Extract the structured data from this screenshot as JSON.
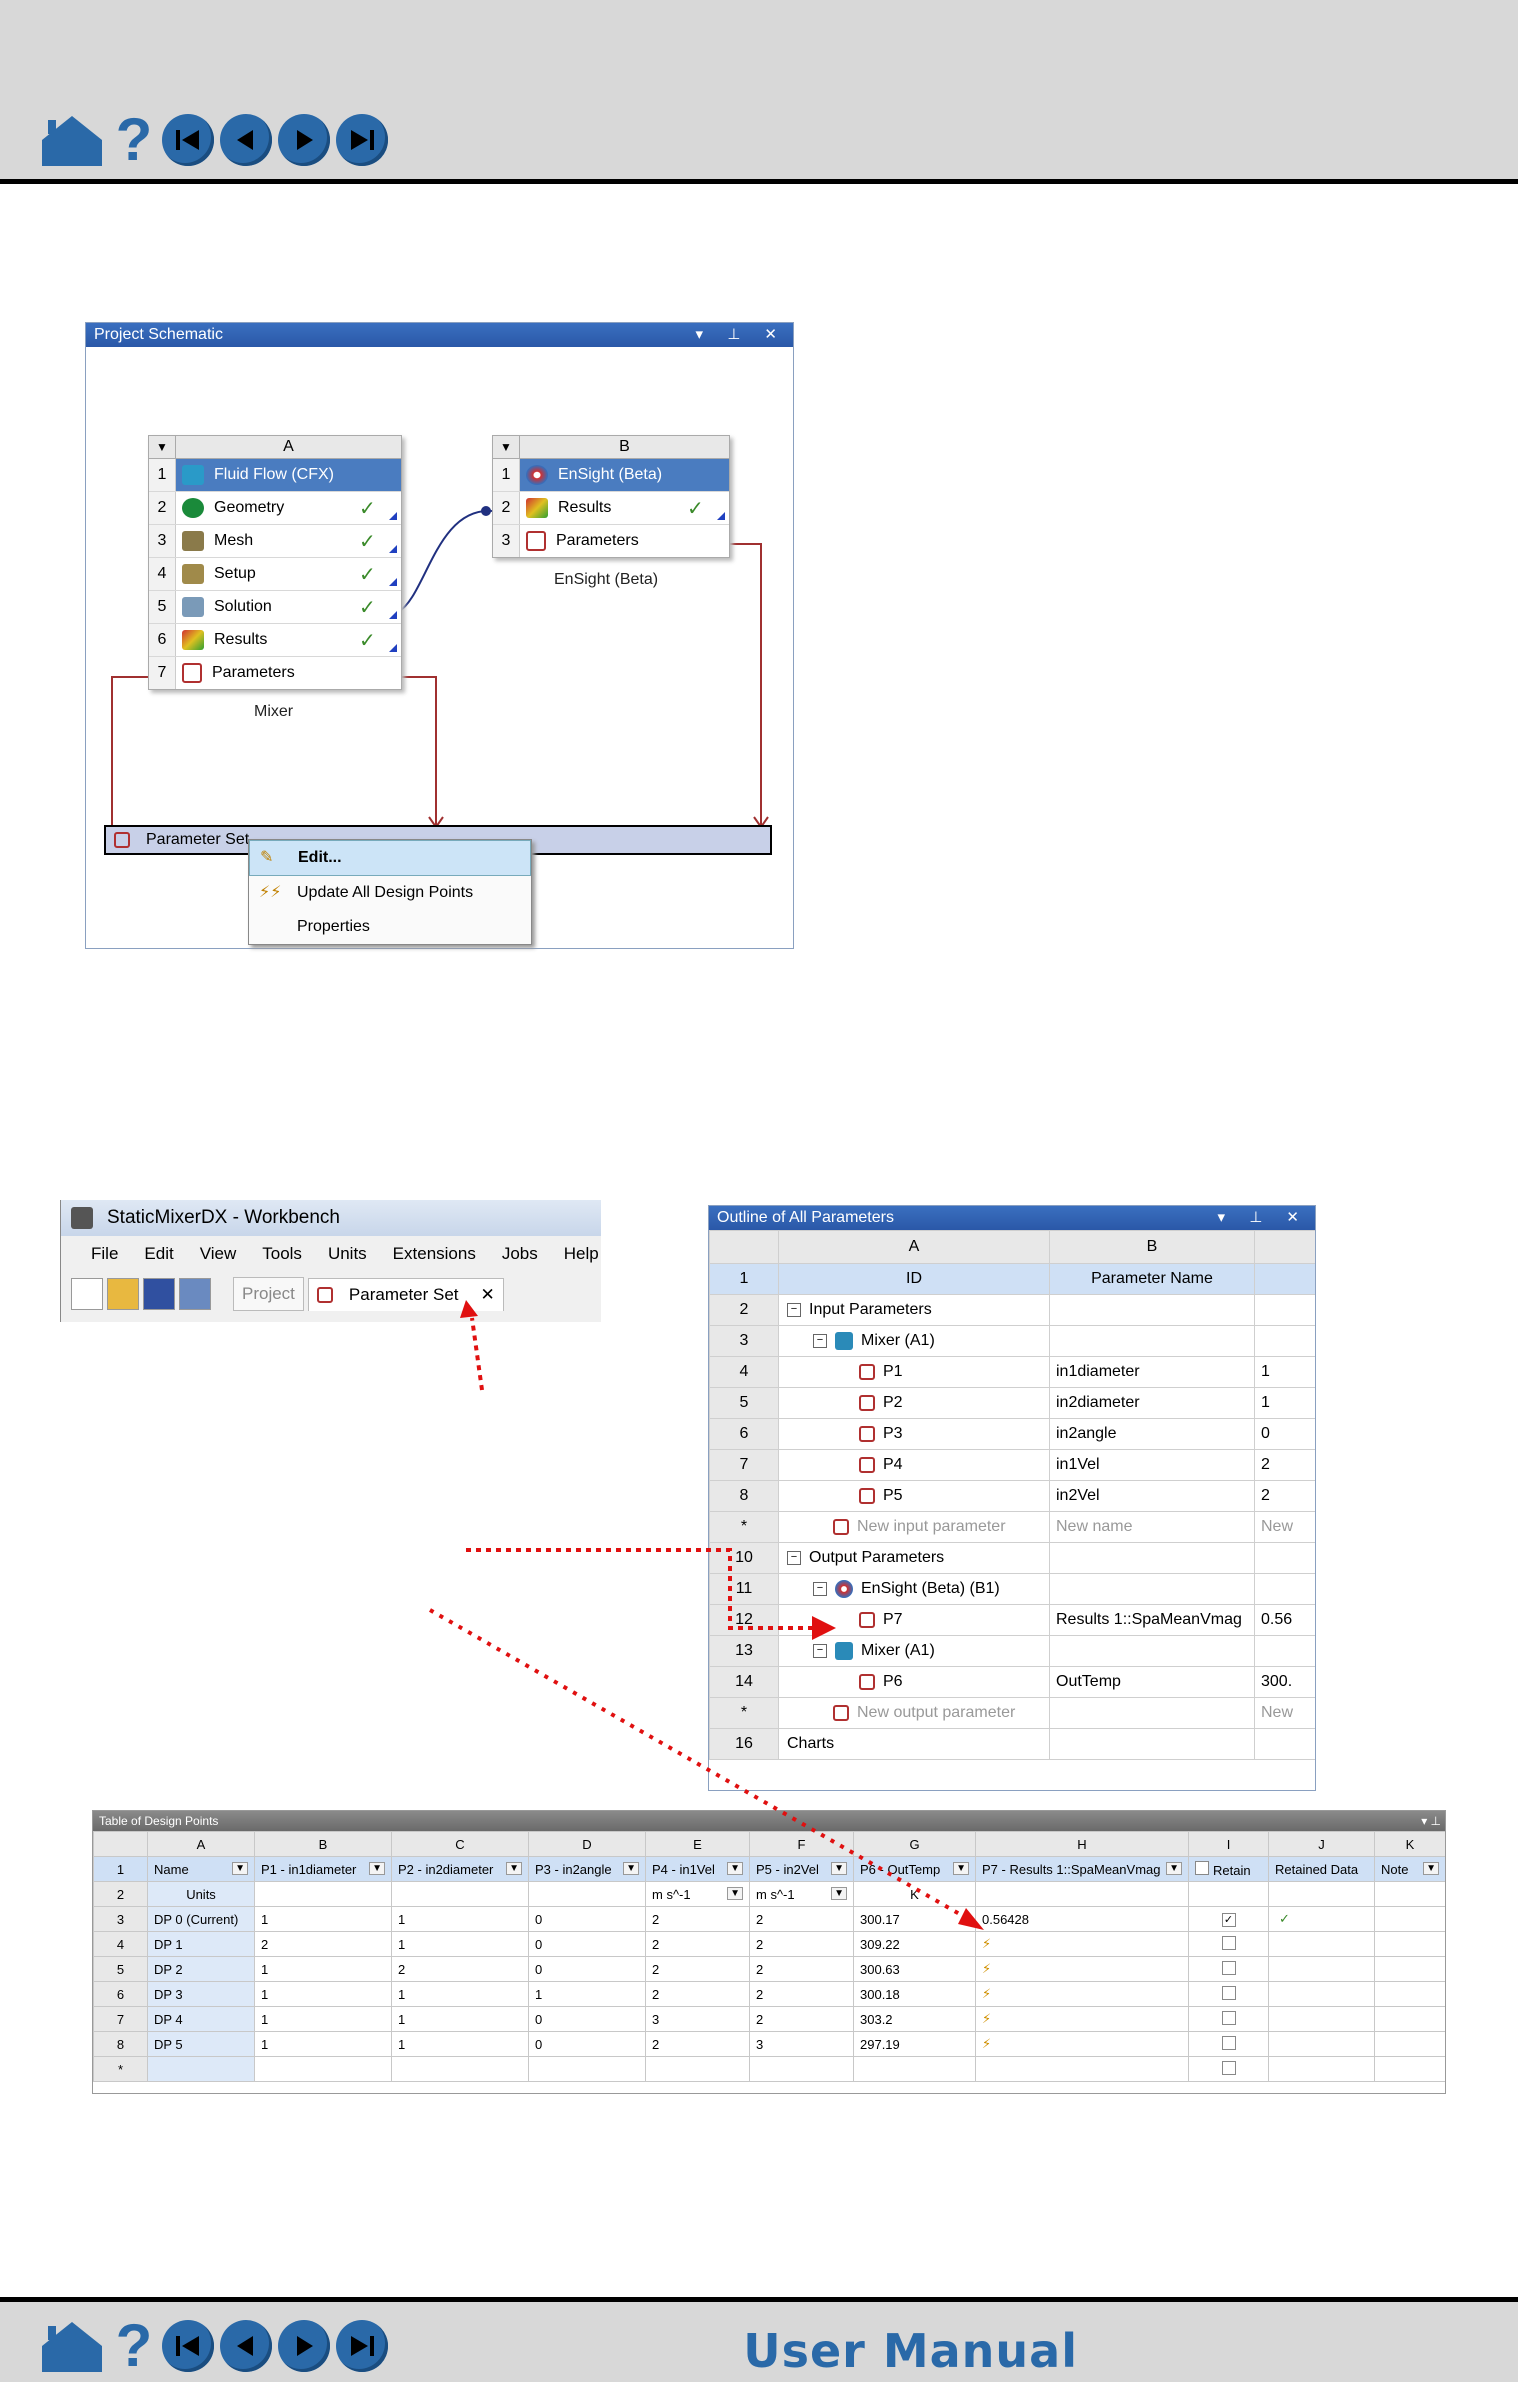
{
  "nav": {
    "help_glyph": "?",
    "footer_title": "User Manual",
    "buttons": [
      "home-icon",
      "help-icon",
      "first-page-icon",
      "prev-page-icon",
      "next-page-icon",
      "last-page-icon"
    ]
  },
  "schematic": {
    "title": "Project Schematic",
    "system_a": {
      "column": "A",
      "rows": [
        {
          "n": "1",
          "label": "Fluid Flow (CFX)",
          "ok": false
        },
        {
          "n": "2",
          "label": "Geometry",
          "ok": true
        },
        {
          "n": "3",
          "label": "Mesh",
          "ok": true
        },
        {
          "n": "4",
          "label": "Setup",
          "ok": true
        },
        {
          "n": "5",
          "label": "Solution",
          "ok": true
        },
        {
          "n": "6",
          "label": "Results",
          "ok": true
        },
        {
          "n": "7",
          "label": "Parameters",
          "ok": false
        }
      ],
      "caption": "Mixer"
    },
    "system_b": {
      "column": "B",
      "rows": [
        {
          "n": "1",
          "label": "EnSight (Beta)",
          "ok": false
        },
        {
          "n": "2",
          "label": "Results",
          "ok": true
        },
        {
          "n": "3",
          "label": "Parameters",
          "ok": false
        }
      ],
      "caption": "EnSight (Beta)"
    },
    "parameter_set": "Parameter Set",
    "menu": {
      "edit": "Edit...",
      "update": "Update All Design Points",
      "properties": "Properties"
    }
  },
  "workbench": {
    "title": "StaticMixerDX - Workbench",
    "menus": [
      "File",
      "Edit",
      "View",
      "Tools",
      "Units",
      "Extensions",
      "Jobs",
      "Help"
    ],
    "tab_project": "Project",
    "tab_param": "Parameter Set",
    "tab_close": "✕"
  },
  "outline": {
    "title": "Outline of All Parameters",
    "col_a": "A",
    "col_b": "B",
    "head_id": "ID",
    "head_name": "Parameter Name",
    "rows": [
      {
        "n": "2",
        "indent": 0,
        "kind": "group",
        "id": "Input Parameters",
        "name": "",
        "val": ""
      },
      {
        "n": "3",
        "indent": 1,
        "kind": "cfx",
        "id": "Mixer (A1)",
        "name": "",
        "val": ""
      },
      {
        "n": "4",
        "indent": 2,
        "kind": "param",
        "id": "P1",
        "name": "in1diameter",
        "val": "1"
      },
      {
        "n": "5",
        "indent": 2,
        "kind": "param",
        "id": "P2",
        "name": "in2diameter",
        "val": "1"
      },
      {
        "n": "6",
        "indent": 2,
        "kind": "param",
        "id": "P3",
        "name": "in2angle",
        "val": "0"
      },
      {
        "n": "7",
        "indent": 2,
        "kind": "param",
        "id": "P4",
        "name": "in1Vel",
        "val": "2"
      },
      {
        "n": "8",
        "indent": 2,
        "kind": "param",
        "id": "P5",
        "name": "in2Vel",
        "val": "2"
      },
      {
        "n": "*",
        "indent": 1,
        "kind": "new",
        "id": "New input parameter",
        "name": "New name",
        "val": "New"
      },
      {
        "n": "10",
        "indent": 0,
        "kind": "group",
        "id": "Output Parameters",
        "name": "",
        "val": ""
      },
      {
        "n": "11",
        "indent": 1,
        "kind": "ens",
        "id": "EnSight (Beta) (B1)",
        "name": "",
        "val": ""
      },
      {
        "n": "12",
        "indent": 2,
        "kind": "param",
        "id": "P7",
        "name": "Results 1::SpaMeanVmag",
        "val": "0.56"
      },
      {
        "n": "13",
        "indent": 1,
        "kind": "cfx",
        "id": "Mixer (A1)",
        "name": "",
        "val": ""
      },
      {
        "n": "14",
        "indent": 2,
        "kind": "param",
        "id": "P6",
        "name": "OutTemp",
        "val": "300."
      },
      {
        "n": "*",
        "indent": 1,
        "kind": "new",
        "id": "New output parameter",
        "name": "",
        "val": "New"
      },
      {
        "n": "16",
        "indent": 0,
        "kind": "plain",
        "id": "Charts",
        "name": "",
        "val": ""
      }
    ]
  },
  "design_points": {
    "title": "Table of Design Points",
    "cols": [
      "A",
      "B",
      "C",
      "D",
      "E",
      "F",
      "G",
      "H",
      "I",
      "J",
      "K"
    ],
    "headers": [
      "Name",
      "P1 - in1diameter",
      "P2 - in2diameter",
      "P3 - in2angle",
      "P4 - in1Vel",
      "P5 - in2Vel",
      "P6 - OutTemp",
      "P7 - Results 1::SpaMeanVmag",
      "Retain",
      "Retained Data",
      "Note"
    ],
    "units_label": "Units",
    "units": [
      "",
      "",
      "",
      "m s^-1",
      "m s^-1",
      "K",
      ""
    ],
    "rows": [
      {
        "n": "3",
        "cells": [
          "DP 0 (Current)",
          "1",
          "1",
          "0",
          "2",
          "2",
          "300.17",
          "0.56428"
        ],
        "retain": true,
        "data": "✓"
      },
      {
        "n": "4",
        "cells": [
          "DP 1",
          "2",
          "1",
          "0",
          "2",
          "2",
          "309.22",
          "⚡"
        ],
        "retain": false,
        "data": ""
      },
      {
        "n": "5",
        "cells": [
          "DP 2",
          "1",
          "2",
          "0",
          "2",
          "2",
          "300.63",
          "⚡"
        ],
        "retain": false,
        "data": ""
      },
      {
        "n": "6",
        "cells": [
          "DP 3",
          "1",
          "1",
          "1",
          "2",
          "2",
          "300.18",
          "⚡"
        ],
        "retain": false,
        "data": ""
      },
      {
        "n": "7",
        "cells": [
          "DP 4",
          "1",
          "1",
          "0",
          "3",
          "2",
          "303.2",
          "⚡"
        ],
        "retain": false,
        "data": ""
      },
      {
        "n": "8",
        "cells": [
          "DP 5",
          "1",
          "1",
          "0",
          "2",
          "3",
          "297.19",
          "⚡"
        ],
        "retain": false,
        "data": ""
      }
    ],
    "last_row_n": "*"
  }
}
